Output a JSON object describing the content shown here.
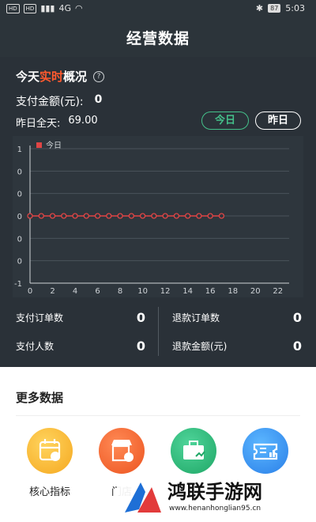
{
  "status_bar": {
    "time": "5:03",
    "battery": "87",
    "chip1": "HD",
    "chip2": "HD",
    "net": "4G"
  },
  "header": {
    "title": "经营数据"
  },
  "realtime": {
    "title_prefix": "今天",
    "title_highlight": "实时",
    "title_suffix": "概况",
    "help_icon": "?",
    "pay_amount_label": "支付金额(元):",
    "pay_amount_value": "0",
    "yesterday_label": "昨日全天:",
    "yesterday_value": "69.00",
    "btn_today": "今日",
    "btn_yesterday": "昨日"
  },
  "chart_data": {
    "type": "line",
    "legend": [
      "今日"
    ],
    "x_ticks": [
      "0",
      "2",
      "4",
      "6",
      "8",
      "10",
      "12",
      "14",
      "16",
      "18",
      "20",
      "22"
    ],
    "y_ticks": [
      "1",
      "0",
      "0",
      "0",
      "0",
      "0",
      "-1"
    ],
    "xlim": [
      0,
      23
    ],
    "ylim": [
      -1,
      1
    ],
    "series": [
      {
        "name": "今日",
        "x": [
          0,
          1,
          2,
          3,
          4,
          5,
          6,
          7,
          8,
          9,
          10,
          11,
          12,
          13,
          14,
          15,
          16,
          17
        ],
        "values": [
          0,
          0,
          0,
          0,
          0,
          0,
          0,
          0,
          0,
          0,
          0,
          0,
          0,
          0,
          0,
          0,
          0,
          0
        ]
      }
    ],
    "grid": true,
    "colors": {
      "line": "#e04545",
      "grid": "#4a535b",
      "axis": "#d0d4d8"
    }
  },
  "stats": [
    {
      "label": "支付订单数",
      "value": "0"
    },
    {
      "label": "退款订单数",
      "value": "0"
    },
    {
      "label": "支付人数",
      "value": "0"
    },
    {
      "label": "退款金额(元)",
      "value": "0"
    }
  ],
  "more": {
    "title": "更多数据",
    "tiles": [
      {
        "label": "核心指标",
        "icon": "calendar-chart-icon"
      },
      {
        "label": "门店",
        "icon": "store-chart-icon"
      },
      {
        "label": "",
        "icon": "briefcase-chart-icon"
      },
      {
        "label": "",
        "icon": "ticket-chart-icon"
      }
    ]
  },
  "watermark": {
    "text": "鸿联手游网",
    "url": "www.henanhonglian95.cn"
  },
  "colors": {
    "accent": "#ff5a2e",
    "green": "#44c08a",
    "bg": "#2a3138"
  }
}
